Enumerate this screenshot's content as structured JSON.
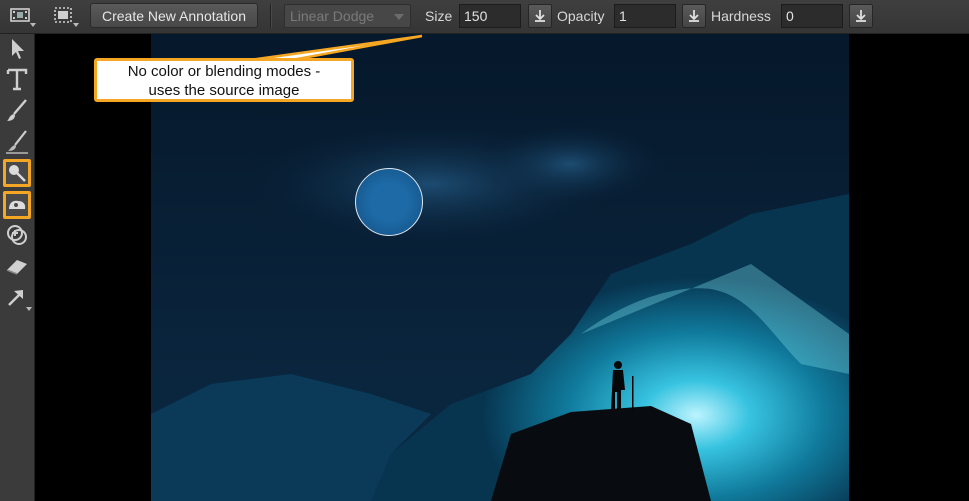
{
  "toolbar": {
    "film_icon": "film-frame-icon",
    "frame_icon": "frame-select-icon",
    "create_label": "Create New Annotation",
    "blend_mode": "Linear Dodge",
    "size_label": "Size",
    "size_value": "150",
    "opacity_label": "Opacity",
    "opacity_value": "1",
    "hardness_label": "Hardness",
    "hardness_value": "0",
    "download_icon": "download-icon"
  },
  "tools": [
    {
      "icon": "select-arrow-icon",
      "highlighted": false
    },
    {
      "icon": "text-icon",
      "highlighted": false
    },
    {
      "icon": "paint-brush-icon",
      "highlighted": false
    },
    {
      "icon": "soft-brush-icon",
      "highlighted": false
    },
    {
      "icon": "dodge-icon",
      "highlighted": true
    },
    {
      "icon": "burn-icon",
      "highlighted": true
    },
    {
      "icon": "clone-icon",
      "highlighted": false
    },
    {
      "icon": "eraser-icon",
      "highlighted": false
    },
    {
      "icon": "arrow-pointer-icon",
      "highlighted": false
    }
  ],
  "callout": {
    "line1": "No color or blending modes -",
    "line2": "uses the source image"
  },
  "colors": {
    "highlight": "#f5a623",
    "toolbar_bg": "#3b3b3b",
    "canvas_bg": "#041526"
  }
}
